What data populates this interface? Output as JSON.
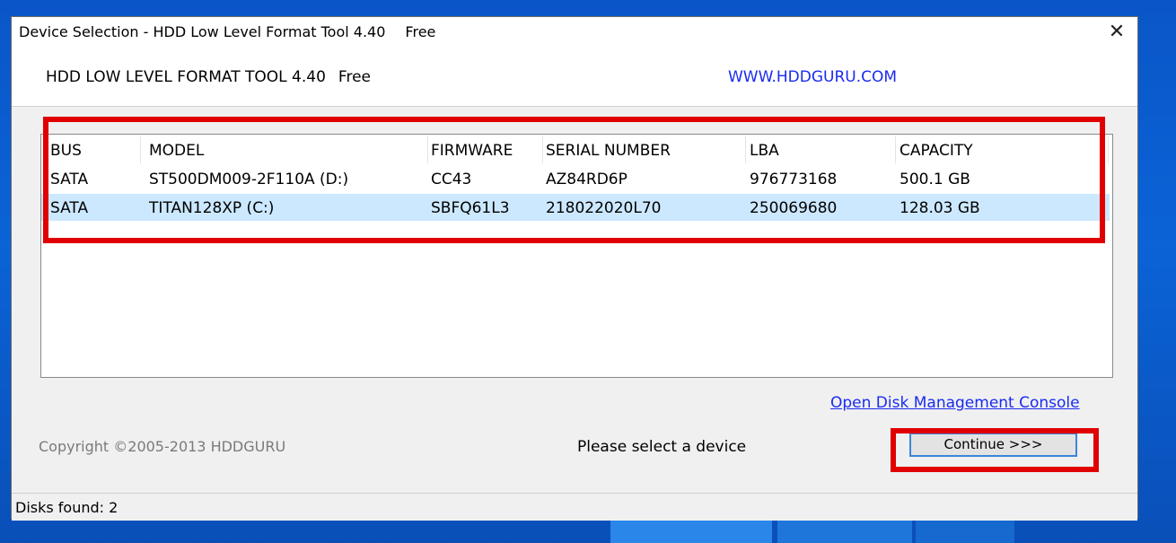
{
  "window": {
    "title": "Device Selection - HDD Low Level Format Tool 4.40",
    "title_suffix": "Free",
    "close_symbol": "✕"
  },
  "header": {
    "app_name": "HDD LOW LEVEL FORMAT TOOL 4.40",
    "app_suffix": "Free",
    "website": "WWW.HDDGURU.COM"
  },
  "device_list": {
    "columns": [
      "BUS",
      "MODEL",
      "FIRMWARE",
      "SERIAL NUMBER",
      "LBA",
      "CAPACITY"
    ],
    "rows": [
      {
        "bus": "SATA",
        "model": "ST500DM009-2F110A (D:)",
        "firmware": "CC43",
        "serial": "AZ84RD6P",
        "lba": "976773168",
        "capacity": "500.1 GB",
        "selected": false
      },
      {
        "bus": "SATA",
        "model": "TITAN128XP (C:)",
        "firmware": "SBFQ61L3",
        "serial": "218022020L70",
        "lba": "250069680",
        "capacity": "128.03 GB",
        "selected": true
      }
    ]
  },
  "links": {
    "disk_management": "Open Disk Management Console"
  },
  "footer": {
    "copyright": "Copyright ©2005-2013 HDDGURU",
    "status_message": "Please select a device",
    "continue_label": "Continue >>>"
  },
  "statusbar": {
    "disks_found": "Disks found: 2"
  },
  "colors": {
    "highlight": "#cce8ff",
    "link": "#1a2bf0",
    "annotation": "#e00000"
  }
}
